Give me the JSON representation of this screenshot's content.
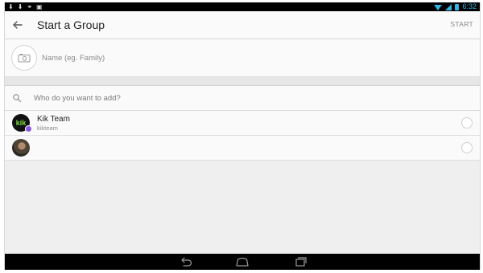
{
  "status_bar": {
    "time": "6:32"
  },
  "app_bar": {
    "title": "Start a Group",
    "action_label": "START"
  },
  "group_name": {
    "placeholder": "Name (eg. Family)"
  },
  "search": {
    "placeholder": "Who do you want to add?"
  },
  "contacts": [
    {
      "name": "Kik Team",
      "username": "kikteam",
      "avatar_text": "kik",
      "verified": true
    },
    {
      "name": "",
      "username": "",
      "avatar_text": "",
      "verified": false
    }
  ],
  "icons": {
    "back": "arrow-left-icon",
    "camera": "camera-icon",
    "search": "search-icon",
    "nav_back": "back-nav-icon",
    "nav_home": "home-nav-icon",
    "nav_recent": "recent-apps-icon"
  },
  "colors": {
    "accent": "#33b5e5",
    "kik_green": "#7ddc3a",
    "badge_purple": "#8a56e2"
  }
}
